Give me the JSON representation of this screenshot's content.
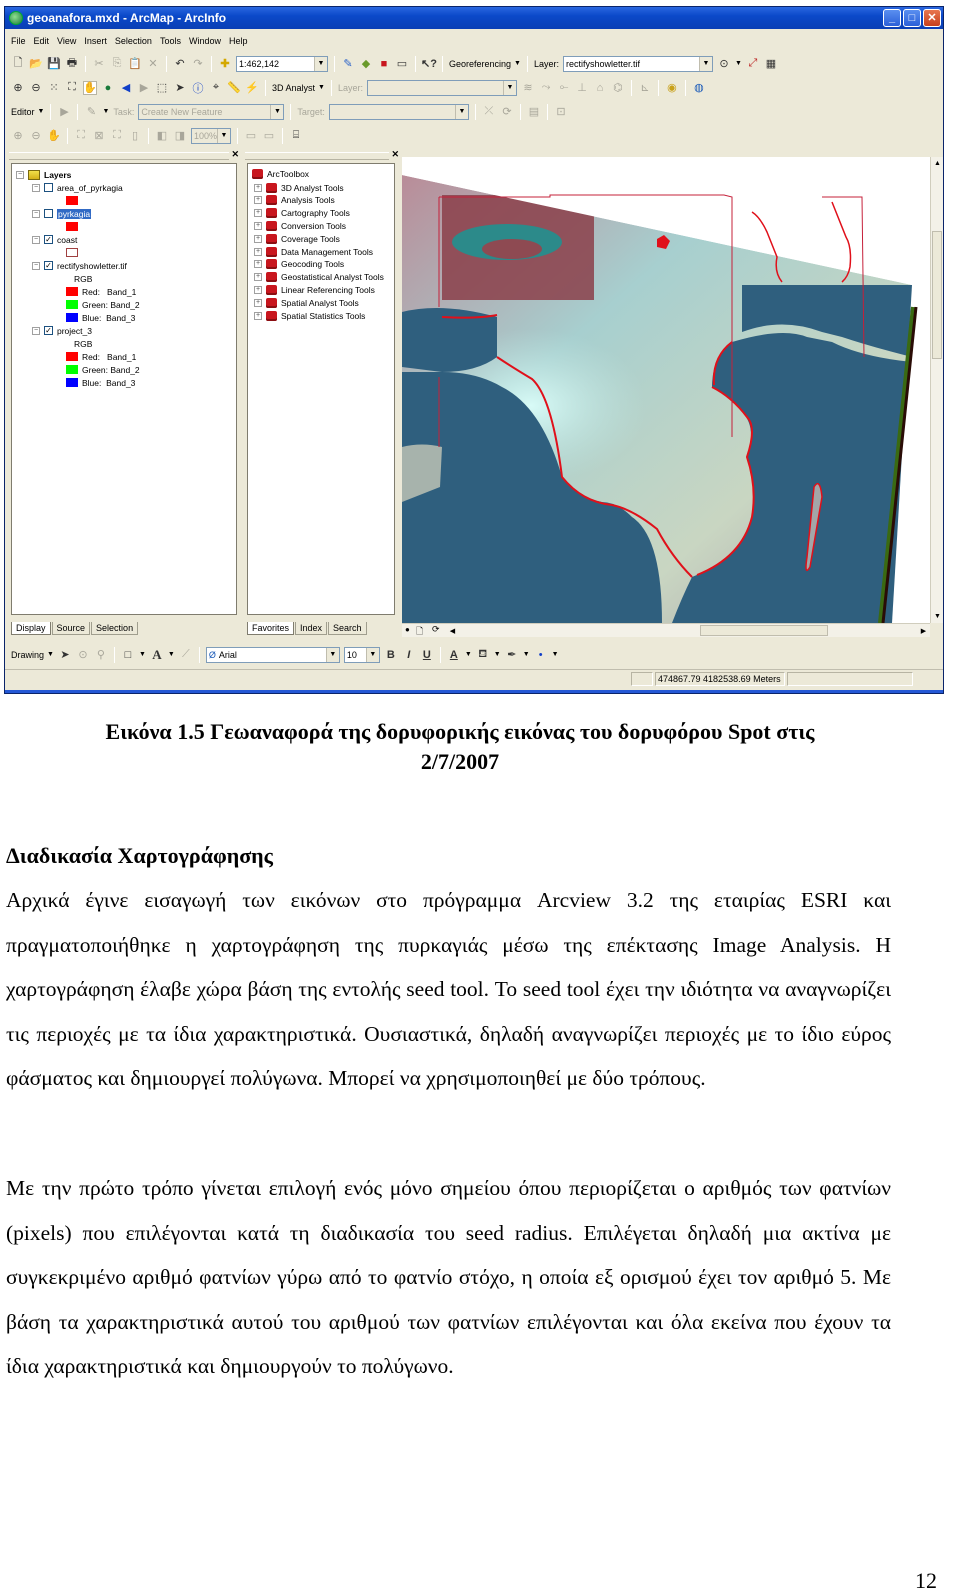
{
  "window": {
    "title": "geoanafora.mxd - ArcMap - ArcInfo",
    "buttons": [
      "minimize",
      "maximize",
      "close"
    ]
  },
  "menu": [
    "File",
    "Edit",
    "View",
    "Insert",
    "Selection",
    "Tools",
    "Window",
    "Help"
  ],
  "standard_toolbar": {
    "scale": "1:462,142",
    "georeferencing_label": "Georeferencing",
    "layer_label": "Layer:",
    "layer_value": "rectifyshowletter.tif"
  },
  "tools_toolbar": {
    "analyst_label": "3D Analyst",
    "layer_label": "Layer:",
    "layer_value": ""
  },
  "editor_toolbar": {
    "editor_label": "Editor",
    "task_label": "Task:",
    "task_value": "Create New Feature",
    "target_label": "Target:",
    "target_value": ""
  },
  "layout_toolbar": {
    "zoom_value": "100%"
  },
  "toc": {
    "root_label": "Layers",
    "layers": [
      {
        "name": "area_of_pyrkagia",
        "checked": false,
        "selected": false,
        "symbols": [
          {
            "color": "#ff0000",
            "label": ""
          }
        ]
      },
      {
        "name": "pyrkagia",
        "checked": false,
        "selected": true,
        "symbols": [
          {
            "color": "#ff0000",
            "label": ""
          }
        ]
      },
      {
        "name": "coast",
        "checked": true,
        "selected": false,
        "symbols": [
          {
            "color": "outline",
            "label": ""
          }
        ]
      },
      {
        "name": "rectifyshowletter.tif",
        "checked": true,
        "selected": false,
        "rgb_label": "RGB",
        "symbols": [
          {
            "color": "#ff0000",
            "label": "Red:   Band_1"
          },
          {
            "color": "#00ff00",
            "label": "Green: Band_2"
          },
          {
            "color": "#0000ff",
            "label": "Blue:  Band_3"
          }
        ]
      },
      {
        "name": "project_3",
        "checked": true,
        "selected": false,
        "rgb_label": "RGB",
        "symbols": [
          {
            "color": "#ff0000",
            "label": "Red:   Band_1"
          },
          {
            "color": "#00ff00",
            "label": "Green: Band_2"
          },
          {
            "color": "#0000ff",
            "label": "Blue:  Band_3"
          }
        ]
      }
    ],
    "tabs": [
      "Display",
      "Source",
      "Selection"
    ],
    "active_tab": "Display"
  },
  "arctoolbox": {
    "root_label": "ArcToolbox",
    "items": [
      "3D Analyst Tools",
      "Analysis Tools",
      "Cartography Tools",
      "Conversion Tools",
      "Coverage Tools",
      "Data Management Tools",
      "Geocoding Tools",
      "Geostatistical Analyst Tools",
      "Linear Referencing Tools",
      "Spatial Analyst Tools",
      "Spatial Statistics Tools"
    ],
    "tabs": [
      "Favorites",
      "Index",
      "Search"
    ],
    "active_tab": "Favorites"
  },
  "drawing_toolbar": {
    "drawing_label": "Drawing",
    "font_value": "Arial",
    "size_value": "10",
    "bold": "B",
    "italic": "I",
    "underline": "U",
    "font_color_label": "A"
  },
  "status_bar": {
    "coordinates": "474867.79  4182538.69 Meters"
  },
  "document": {
    "caption_line1": "Εικόνα 1.5 Γεωαναφορά της δορυφορικής εικόνας του δορυφόρου Spot στις",
    "caption_line2": "2/7/2007",
    "section_heading": "Διαδικασία Χαρτογράφησης",
    "paragraph_1": "Αρχικά έγινε εισαγωγή των εικόνων στο πρόγραμμα Arcview 3.2 της εταιρίας ESRI και πραγματοποιήθηκε η χαρτογράφηση της πυρκαγιάς μέσω της επέκτασης Image Analysis. Η χαρτογράφηση έλαβε χώρα βάση της εντολής seed tool. Το seed tool έχει την ιδιότητα να αναγνωρίζει τις περιοχές με τα ίδια χαρακτηριστικά. Ουσιαστικά, δηλαδή αναγνωρίζει περιοχές με το ίδιο εύρος φάσματος και δημιουργεί πολύγωνα. Μπορεί να χρησιμοποιηθεί με δύο τρόπους.",
    "paragraph_2": "Με την πρώτο τρόπο γίνεται επιλογή ενός μόνο σημείου όπου περιορίζεται ο αριθμός των φατνίων (pixels) που επιλέγονται κατά τη διαδικασία του seed radius. Επιλέγεται δηλαδή μια ακτίνα με συγκεκριμένο αριθμό φατνίων γύρω από το φατνίο στόχο, η οποία εξ ορισμού έχει τον αριθμό 5. Με βάση τα χαρακτηριστικά αυτού του αριθμού των φατνίων επιλέγονται και όλα εκείνα που έχουν τα ίδια χαρακτηριστικά και δημιουργούν το πολύγωνο.",
    "page_number": "12"
  },
  "colors": {
    "titlebar": "#0b49c9",
    "chrome": "#ece9d8",
    "selection": "#316ac5",
    "sea": "#2f5f7e",
    "fire_outline": "#e0101a"
  }
}
